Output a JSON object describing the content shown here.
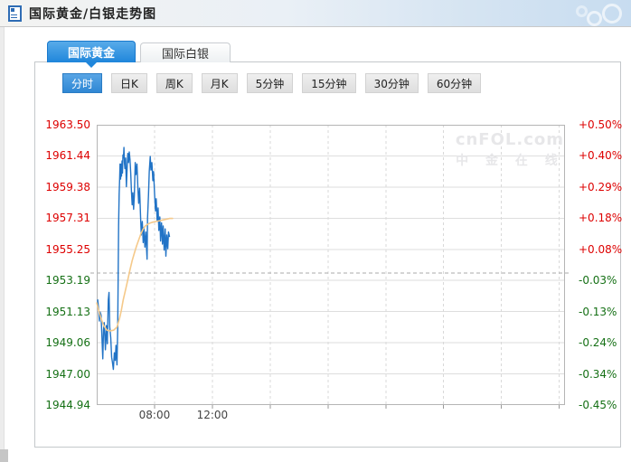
{
  "page": {
    "title": "国际黄金/白银走势图"
  },
  "tabs": [
    {
      "name": "tab-international-gold",
      "label": "国际黄金",
      "active": true
    },
    {
      "name": "tab-international-silver",
      "label": "国际白银",
      "active": false
    }
  ],
  "periods": [
    {
      "name": "period-timeline",
      "label": "分时",
      "active": true
    },
    {
      "name": "period-daily-k",
      "label": "日K",
      "active": false
    },
    {
      "name": "period-weekly-k",
      "label": "周K",
      "active": false
    },
    {
      "name": "period-monthly-k",
      "label": "月K",
      "active": false
    },
    {
      "name": "period-5min",
      "label": "5分钟",
      "active": false
    },
    {
      "name": "period-15min",
      "label": "15分钟",
      "active": false
    },
    {
      "name": "period-30min",
      "label": "30分钟",
      "active": false
    },
    {
      "name": "period-60min",
      "label": "60分钟",
      "active": false
    }
  ],
  "colors": {
    "up": "#dd0000",
    "down": "#157015",
    "accent": "#1f86db",
    "price_line": "#2173c6",
    "avg_line": "#f5c98a",
    "grid": "#dedede",
    "grid_dash": "#d9d9d9",
    "plot_border": "#b5b5b5",
    "prev_close_line": "#aaaaaa",
    "watermark": "#e7e7e9"
  },
  "chart_data": {
    "type": "line",
    "ylim": [
      1944.94,
      1963.5
    ],
    "y_ticks": [
      1963.5,
      1961.44,
      1959.38,
      1957.31,
      1955.25,
      1953.19,
      1951.13,
      1949.06,
      1947.0,
      1944.94
    ],
    "pct_ticks": [
      "+0.50%",
      "+0.40%",
      "+0.29%",
      "+0.18%",
      "+0.08%",
      "-0.03%",
      "-0.13%",
      "-0.24%",
      "-0.34%",
      "-0.45%"
    ],
    "prev_close": 1953.68,
    "x_axis_start": "04:00",
    "x_hours_total": 32.4,
    "x_grid_hours": [
      4,
      8,
      12,
      16,
      20,
      24,
      28,
      32
    ],
    "x_tick_labels": [
      {
        "hour": 4,
        "label": "08:00"
      },
      {
        "hour": 8,
        "label": "12:00"
      }
    ],
    "watermark_line1": "cnFOL.com",
    "watermark_line2": "中 金 在 线",
    "series": [
      {
        "name": "price",
        "color_key": "price_line",
        "width": 1.4,
        "points": [
          [
            4,
            1951.9
          ],
          [
            8,
            1951.3
          ],
          [
            11,
            1950.5
          ],
          [
            14,
            1951.1
          ],
          [
            18,
            1950.9
          ],
          [
            21,
            1949.7
          ],
          [
            25,
            1948.0
          ],
          [
            28,
            1949.9
          ],
          [
            31,
            1950.4
          ],
          [
            36,
            1948.6
          ],
          [
            40,
            1950.2
          ],
          [
            44,
            1949.0
          ],
          [
            48,
            1951.9
          ],
          [
            51,
            1952.4
          ],
          [
            54,
            1950.1
          ],
          [
            58,
            1949.4
          ],
          [
            62,
            1948.1
          ],
          [
            65,
            1947.8
          ],
          [
            69,
            1947.3
          ],
          [
            73,
            1948.4
          ],
          [
            77,
            1947.9
          ],
          [
            80,
            1948.9
          ],
          [
            84,
            1947.6
          ],
          [
            87,
            1950.0
          ],
          [
            89,
            1953.4
          ],
          [
            91,
            1956.8
          ],
          [
            93,
            1958.9
          ],
          [
            95,
            1959.8
          ],
          [
            97,
            1960.9
          ],
          [
            99,
            1959.9
          ],
          [
            101,
            1960.9
          ],
          [
            103,
            1960.1
          ],
          [
            105,
            1961.1
          ],
          [
            107,
            1960.3
          ],
          [
            109,
            1961.5
          ],
          [
            111,
            1961.3
          ],
          [
            113,
            1962.0
          ],
          [
            115,
            1961.0
          ],
          [
            117,
            1960.6
          ],
          [
            120,
            1961.3
          ],
          [
            123,
            1959.4
          ],
          [
            126,
            1960.6
          ],
          [
            129,
            1961.6
          ],
          [
            132,
            1961.0
          ],
          [
            135,
            1961.7
          ],
          [
            138,
            1961.2
          ],
          [
            141,
            1960.3
          ],
          [
            144,
            1959.1
          ],
          [
            147,
            1958.2
          ],
          [
            150,
            1959.0
          ],
          [
            153,
            1957.9
          ],
          [
            156,
            1958.8
          ],
          [
            160,
            1961.0
          ],
          [
            163,
            1960.2
          ],
          [
            167,
            1960.9
          ],
          [
            171,
            1959.2
          ],
          [
            174,
            1958.3
          ],
          [
            178,
            1959.3
          ],
          [
            182,
            1957.4
          ],
          [
            185,
            1956.2
          ],
          [
            189,
            1957.1
          ],
          [
            193,
            1955.7
          ],
          [
            196,
            1956.7
          ],
          [
            200,
            1955.4
          ],
          [
            204,
            1956.4
          ],
          [
            207,
            1955.2
          ],
          [
            209,
            1954.6
          ],
          [
            211,
            1957.3
          ],
          [
            215,
            1958.9
          ],
          [
            218,
            1960.4
          ],
          [
            222,
            1961.4
          ],
          [
            225,
            1960.5
          ],
          [
            229,
            1961.0
          ],
          [
            233,
            1959.8
          ],
          [
            236,
            1960.4
          ],
          [
            240,
            1958.9
          ],
          [
            244,
            1957.8
          ],
          [
            247,
            1958.6
          ],
          [
            251,
            1957.1
          ],
          [
            255,
            1958.0
          ],
          [
            258,
            1956.5
          ],
          [
            262,
            1957.4
          ],
          [
            265,
            1955.8
          ],
          [
            269,
            1957.0
          ],
          [
            273,
            1955.6
          ],
          [
            276,
            1956.8
          ],
          [
            280,
            1955.2
          ],
          [
            284,
            1956.6
          ],
          [
            287,
            1954.8
          ],
          [
            291,
            1956.2
          ],
          [
            295,
            1955.3
          ],
          [
            298,
            1956.4
          ],
          [
            302,
            1956.1
          ]
        ]
      },
      {
        "name": "average",
        "color_key": "avg_line",
        "width": 1.6,
        "points": [
          [
            0,
            1951.7
          ],
          [
            15,
            1950.8
          ],
          [
            29,
            1950.2
          ],
          [
            42,
            1949.9
          ],
          [
            55,
            1949.85
          ],
          [
            70,
            1949.9
          ],
          [
            84,
            1950.1
          ],
          [
            95,
            1950.7
          ],
          [
            102,
            1951.2
          ],
          [
            110,
            1951.9
          ],
          [
            120,
            1952.6
          ],
          [
            130,
            1953.3
          ],
          [
            138,
            1953.9
          ],
          [
            147,
            1954.5
          ],
          [
            156,
            1955.0
          ],
          [
            166,
            1955.5
          ],
          [
            175,
            1955.9
          ],
          [
            184,
            1956.3
          ],
          [
            193,
            1956.6
          ],
          [
            202,
            1956.8
          ],
          [
            211,
            1956.9
          ],
          [
            222,
            1957.0
          ],
          [
            233,
            1957.05
          ],
          [
            247,
            1957.1
          ],
          [
            262,
            1957.15
          ],
          [
            276,
            1957.2
          ],
          [
            291,
            1957.25
          ],
          [
            302,
            1957.3
          ],
          [
            315,
            1957.3
          ]
        ]
      }
    ]
  }
}
